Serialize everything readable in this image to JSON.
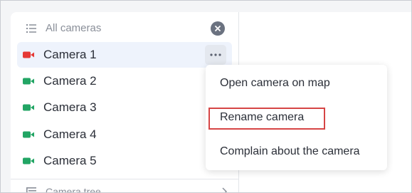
{
  "sidebar": {
    "all_cameras_label": "All cameras",
    "list_icon": "list-icon",
    "clear_icon": "close-icon",
    "cameras": [
      {
        "label": "Camera 1",
        "status_color": "#e53935",
        "active": true
      },
      {
        "label": "Camera 2",
        "status_color": "#22a564",
        "active": false
      },
      {
        "label": "Camera 3",
        "status_color": "#22a564",
        "active": false
      },
      {
        "label": "Camera 4",
        "status_color": "#22a564",
        "active": false
      },
      {
        "label": "Camera 5",
        "status_color": "#22a564",
        "active": false
      }
    ],
    "more_icon": "more-horizontal-icon",
    "camera_tree_label": "Camera tree"
  },
  "context_menu": {
    "items": [
      {
        "label": "Open camera on map"
      },
      {
        "label": "Rename camera",
        "highlighted": true
      },
      {
        "label": "Complain about the camera"
      }
    ],
    "highlight_color": "#d64545"
  }
}
